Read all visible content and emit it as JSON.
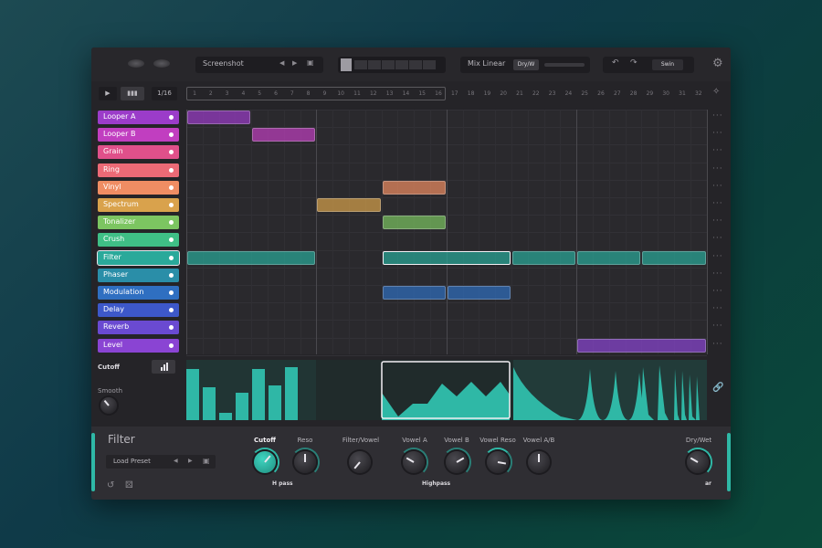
{
  "topbar": {
    "preset_name": "Screenshot",
    "mix_label": "Mix Linear",
    "dry_wet_label": "Dry/W",
    "swing_label": "Swin",
    "undo_icon": "undo-icon",
    "redo_icon": "redo-icon",
    "settings_icon": "gear-icon"
  },
  "transport": {
    "play_icon": "play-icon",
    "rate_label": "1/16"
  },
  "ruler": {
    "steps": [
      "1",
      "2",
      "3",
      "4",
      "5",
      "6",
      "7",
      "8",
      "9",
      "10",
      "11",
      "12",
      "13",
      "14",
      "15",
      "16",
      "17",
      "18",
      "19",
      "20",
      "21",
      "22",
      "23",
      "24",
      "25",
      "26",
      "27",
      "28",
      "29",
      "30",
      "31",
      "32"
    ]
  },
  "tracks": [
    {
      "label": "Looper A",
      "color": "#9b3cc9"
    },
    {
      "label": "Looper B",
      "color": "#c13ec0"
    },
    {
      "label": "Grain",
      "color": "#e0508a"
    },
    {
      "label": "Ring",
      "color": "#ec6a76"
    },
    {
      "label": "Vinyl",
      "color": "#ef8d63"
    },
    {
      "label": "Spectrum",
      "color": "#d9a24c"
    },
    {
      "label": "Tonalizer",
      "color": "#7cc561"
    },
    {
      "label": "Crush",
      "color": "#3fbf86"
    },
    {
      "label": "Filter",
      "color": "#2aa99a"
    },
    {
      "label": "Phaser",
      "color": "#2a8ea8"
    },
    {
      "label": "Modulation",
      "color": "#2f6fc1"
    },
    {
      "label": "Delay",
      "color": "#3d58c9"
    },
    {
      "label": "Reverb",
      "color": "#6a4ad1"
    },
    {
      "label": "Level",
      "color": "#8a44d3"
    }
  ],
  "automation": {
    "param_label": "Cutoff",
    "smooth_label": "Smooth"
  },
  "panel": {
    "title": "Filter",
    "load_preset": "Load Preset",
    "knobs": [
      {
        "label": "Cutoff"
      },
      {
        "label": "Reso"
      },
      {
        "label": "Filter/Vowel"
      },
      {
        "label": "Vowel A"
      },
      {
        "label": "Vowel B"
      },
      {
        "label": "Vowel Reso"
      },
      {
        "label": "Vowel A/B"
      },
      {
        "label": "Dry/Wet"
      }
    ],
    "mode_left": "H    pass",
    "mode_right": "Highpass",
    "mode_drywet": "ar"
  }
}
